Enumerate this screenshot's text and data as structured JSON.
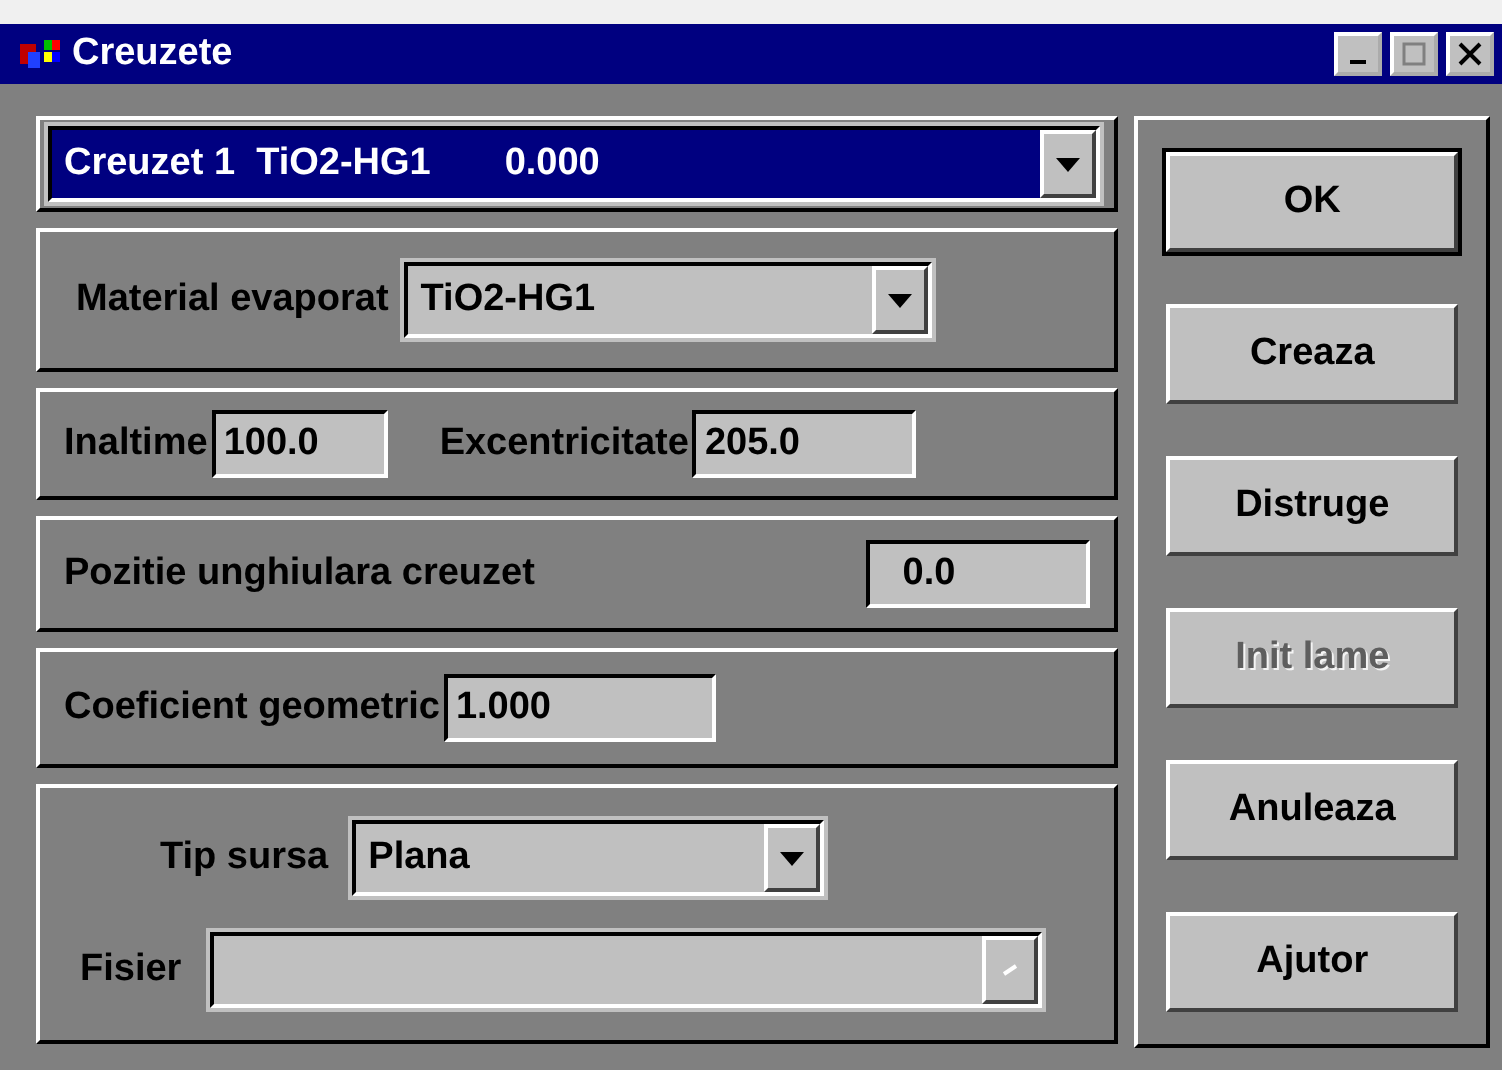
{
  "window": {
    "title": "Creuzete"
  },
  "crucible_select": {
    "value": "Creuzet 1  TiO2-HG1       0.000"
  },
  "material": {
    "label": "Material evaporat",
    "value": "TiO2-HG1"
  },
  "height": {
    "label": "Inaltime",
    "value": "100.0"
  },
  "eccentricity": {
    "label": "Excentricitate",
    "value": "205.0"
  },
  "angular_position": {
    "label": "Pozitie unghiulara creuzet",
    "value": "0.0"
  },
  "geometric_coefficient": {
    "label": "Coeficient geometric",
    "value": "1.000"
  },
  "source_type": {
    "label": "Tip sursa",
    "value": "Plana"
  },
  "file": {
    "label": "Fisier",
    "disabled": true
  },
  "buttons": [
    {
      "label": "OK",
      "default": true,
      "disabled": false
    },
    {
      "label": "Creaza",
      "default": false,
      "disabled": false
    },
    {
      "label": "Distruge",
      "default": false,
      "disabled": false
    },
    {
      "label": "Init lame",
      "default": false,
      "disabled": true
    },
    {
      "label": "Anuleaza",
      "default": false,
      "disabled": false
    },
    {
      "label": "Ajutor",
      "default": false,
      "disabled": false
    }
  ]
}
